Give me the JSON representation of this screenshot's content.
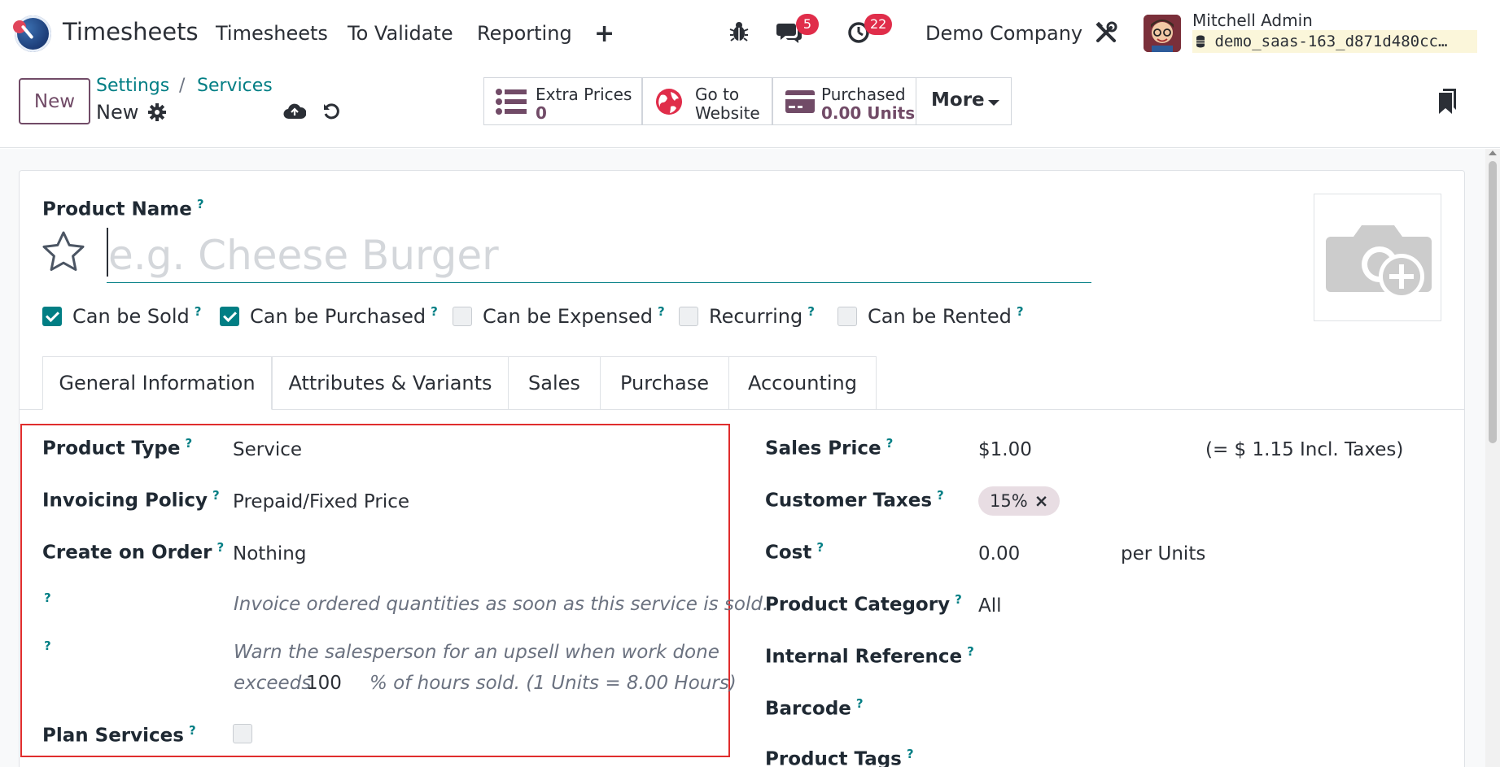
{
  "navbar": {
    "app_title": "Timesheets",
    "menu": [
      "Timesheets",
      "To Validate",
      "Reporting"
    ],
    "add_menu_icon": "+",
    "messages_badge": "5",
    "activities_badge": "22",
    "company": "Demo Company",
    "user_name": "Mitchell Admin",
    "database": "demo_saas-163_d871d480cc…"
  },
  "control": {
    "new_label": "New",
    "breadcrumbs": [
      "Settings",
      "Services"
    ],
    "breadcrumb_sep": "/",
    "record_name": "New",
    "smart_buttons": {
      "extra_prices_label": "Extra Prices",
      "extra_prices_value": "0",
      "website_line1": "Go to",
      "website_line2": "Website",
      "purchased_label": "Purchased",
      "purchased_value": "0.00 Units"
    },
    "more_label": "More"
  },
  "form": {
    "product_name_label": "Product Name",
    "product_name_placeholder": "e.g. Cheese Burger",
    "help_mark": "?",
    "checkboxes": [
      {
        "label": "Can be Sold",
        "checked": true
      },
      {
        "label": "Can be Purchased",
        "checked": true
      },
      {
        "label": "Can be Expensed",
        "checked": false
      },
      {
        "label": "Recurring",
        "checked": false
      },
      {
        "label": "Can be Rented",
        "checked": false
      }
    ],
    "tabs": [
      "General Information",
      "Attributes & Variants",
      "Sales",
      "Purchase",
      "Accounting"
    ],
    "left": {
      "product_type_label": "Product Type",
      "product_type_value": "Service",
      "invoicing_policy_label": "Invoicing Policy",
      "invoicing_policy_value": "Prepaid/Fixed Price",
      "create_on_order_label": "Create on Order",
      "create_on_order_value": "Nothing",
      "invoice_help": "Invoice ordered quantities as soon as this service is sold.",
      "upsell_help_line1": "Warn the salesperson for an upsell when work done",
      "upsell_help_prefix": "exceeds",
      "upsell_threshold": "100",
      "upsell_help_suffix": "% of hours sold. (1 Units = 8.00 Hours)",
      "plan_services_label": "Plan Services"
    },
    "right": {
      "sales_price_label": "Sales Price",
      "sales_price_value": "$1.00",
      "incl_taxes": "(= $ 1.15 Incl. Taxes)",
      "customer_taxes_label": "Customer Taxes",
      "tax_tag": "15%",
      "tag_remove": "×",
      "cost_label": "Cost",
      "cost_value": "0.00",
      "cost_unit": "per Units",
      "category_label": "Product Category",
      "category_value": "All",
      "internal_ref_label": "Internal Reference",
      "barcode_label": "Barcode",
      "tags_label": "Product Tags"
    }
  },
  "colors": {
    "brand": "#714b67",
    "accent": "#017e84",
    "highlight": "#e02d2d",
    "badge": "#e02d4a"
  }
}
